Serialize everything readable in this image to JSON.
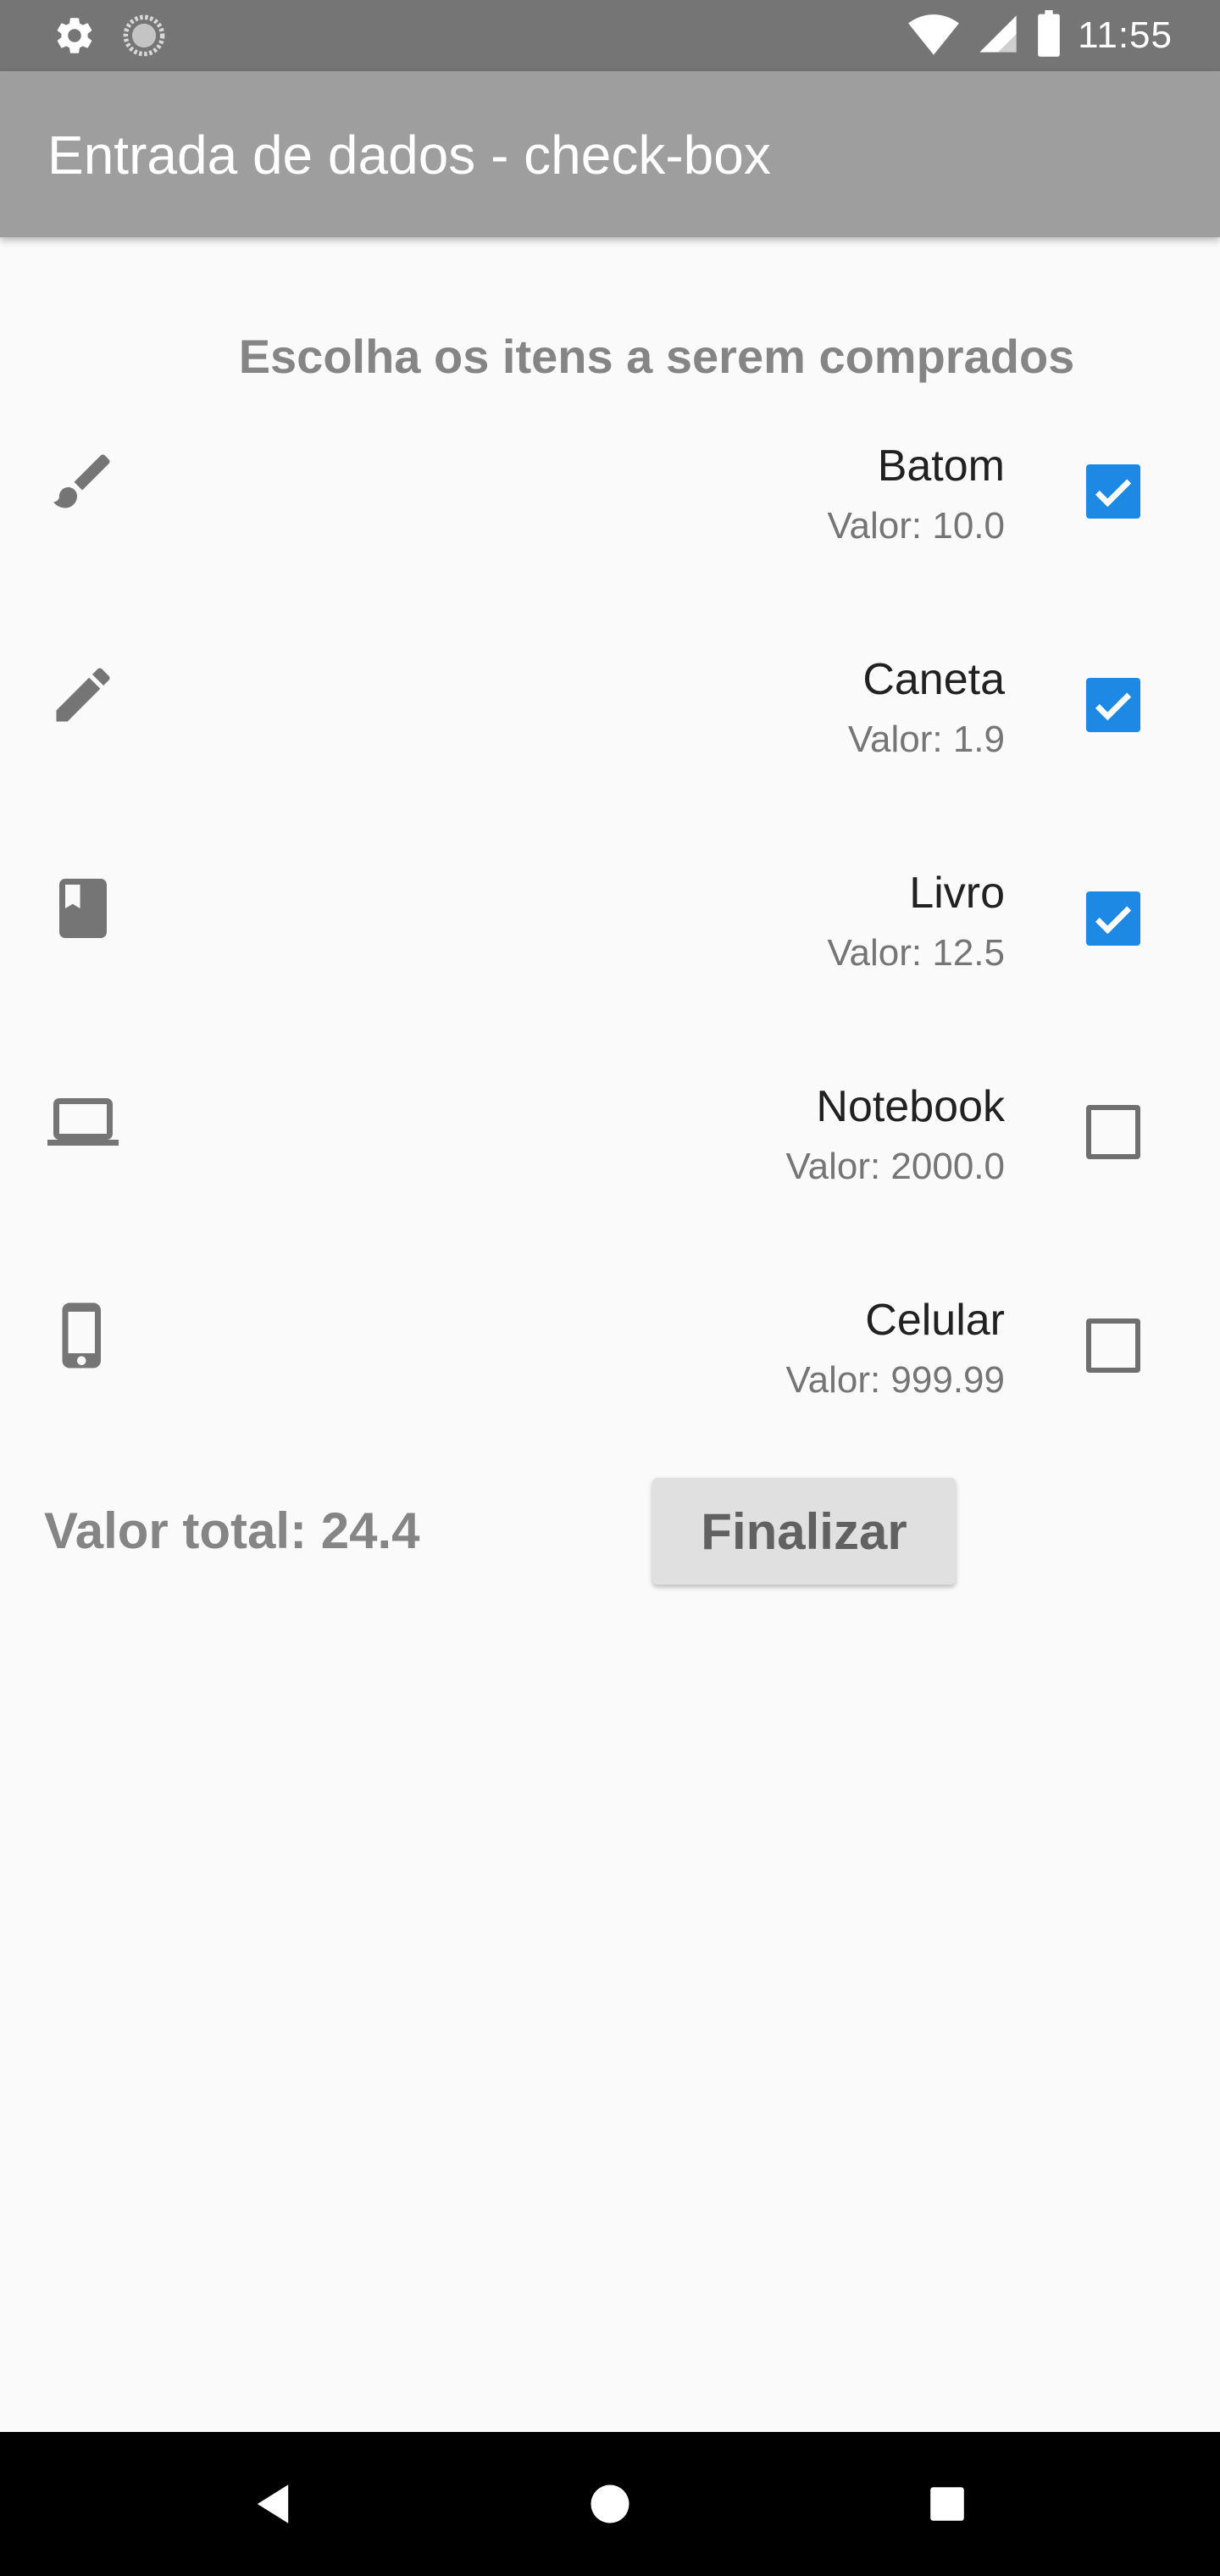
{
  "status_bar": {
    "time": "11:55",
    "icons_left": [
      "gear-icon",
      "loading-icon"
    ],
    "icons_right": [
      "wifi-icon",
      "signal-icon",
      "battery-icon"
    ]
  },
  "app_bar": {
    "title": "Entrada de dados - check-box"
  },
  "main": {
    "section_title": "Escolha os itens a serem comprados",
    "items": [
      {
        "name": "Batom",
        "price": "Valor: 10.0",
        "icon": "brush-icon",
        "checked": true
      },
      {
        "name": "Caneta",
        "price": "Valor: 1.9",
        "icon": "pencil-icon",
        "checked": true
      },
      {
        "name": "Livro",
        "price": "Valor: 12.5",
        "icon": "book-icon",
        "checked": true
      },
      {
        "name": "Notebook",
        "price": "Valor: 2000.0",
        "icon": "laptop-icon",
        "checked": false
      },
      {
        "name": "Celular",
        "price": "Valor: 999.99",
        "icon": "phone-icon",
        "checked": false
      }
    ],
    "total_label": "Valor total: 24.4",
    "finalize_label": "Finalizar"
  },
  "nav_bar": {
    "buttons": [
      "back-icon",
      "home-icon",
      "recents-icon"
    ]
  },
  "colors": {
    "status_bar": "#757575",
    "app_bar": "#9e9e9e",
    "checkbox_accent": "#1e88e5",
    "background": "#fafafa"
  }
}
